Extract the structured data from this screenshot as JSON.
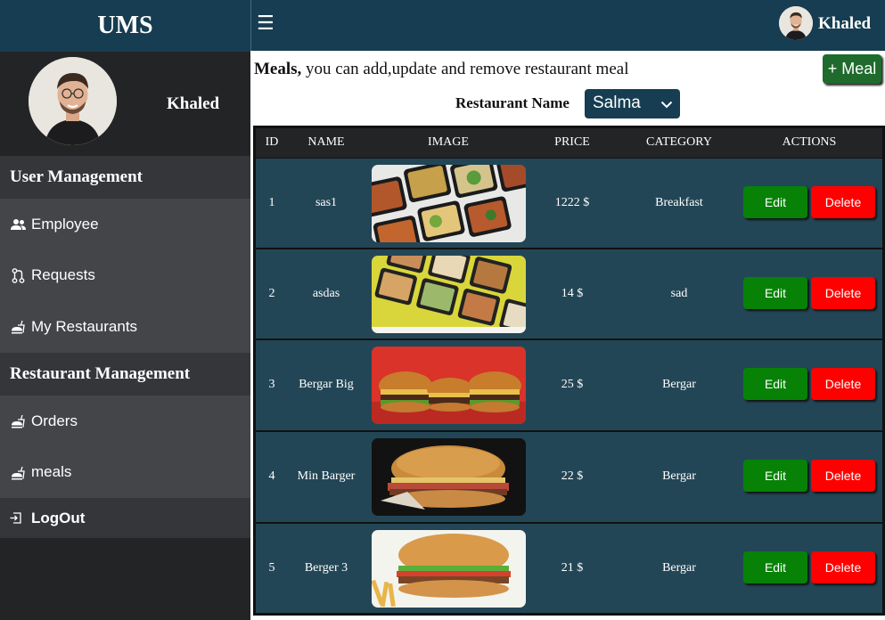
{
  "app": {
    "brand": "UMS"
  },
  "user": {
    "name": "Khaled"
  },
  "topbar": {
    "menu_icon": "hamburger-icon",
    "user_name": "Khaled"
  },
  "sidebar": {
    "sections": [
      {
        "title": "User Management",
        "items": [
          {
            "label": "Employee",
            "icon": "people-icon"
          },
          {
            "label": "Requests",
            "icon": "pull-request-icon"
          },
          {
            "label": "My Restaurants",
            "icon": "food-icon"
          }
        ]
      },
      {
        "title": "Restaurant Management",
        "items": [
          {
            "label": "Orders",
            "icon": "food-icon"
          },
          {
            "label": "meals",
            "icon": "food-icon"
          }
        ]
      }
    ],
    "logout": {
      "label": "LogOut",
      "icon": "logout-icon"
    }
  },
  "page": {
    "title_bold": "Meals,",
    "title_rest": " you can add,update and remove restaurant meal",
    "add_button": "+ Meal",
    "restaurant_label": "Restaurant Name",
    "restaurant_selected": "Salma"
  },
  "table": {
    "columns": [
      "ID",
      "NAME",
      "IMAGE",
      "PRICE",
      "CATEGORY",
      "ACTIONS"
    ],
    "edit_label": "Edit",
    "delete_label": "Delete",
    "rows": [
      {
        "id": "1",
        "name": "sas1",
        "price": "1222 $",
        "category": "Breakfast",
        "image": "meal-prep-boxes"
      },
      {
        "id": "2",
        "name": "asdas",
        "price": "14 $",
        "category": "sad",
        "image": "meal-prep-trays"
      },
      {
        "id": "3",
        "name": "Bergar Big",
        "price": "25 $",
        "category": "Bergar",
        "image": "three-burgers"
      },
      {
        "id": "4",
        "name": "Min Barger",
        "price": "22 $",
        "category": "Bergar",
        "image": "burger-dark"
      },
      {
        "id": "5",
        "name": "Berger 3",
        "price": "21 $",
        "category": "Bergar",
        "image": "burger-fries"
      }
    ]
  },
  "colors": {
    "header": "#163d51",
    "sidebar": "#232426",
    "nav": "#444549",
    "row": "#234656",
    "edit": "#078207",
    "delete": "#ff0000",
    "add": "#1e6b2d"
  }
}
